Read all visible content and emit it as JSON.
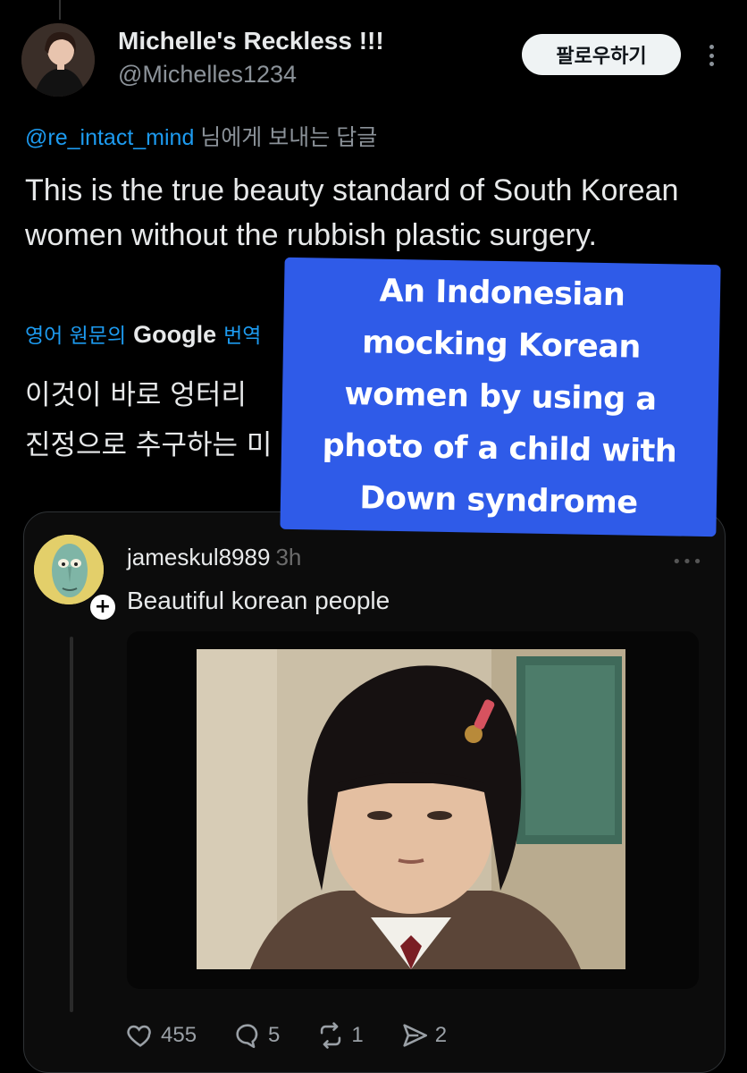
{
  "author": {
    "display_name": "Michelle's Reckless !!!",
    "handle": "@Michelles1234",
    "follow_label": "팔로우하기"
  },
  "reply_context": {
    "mention": "@re_intact_mind",
    "suffix": " 님에게 보내는 답글"
  },
  "tweet": {
    "text": "This is the true beauty standard of South Korean women without the rubbish plastic surgery.",
    "translate_prefix": "영어 원문의",
    "translate_brand": "Google",
    "translate_suffix": "번역",
    "translated_line_1": "이것이 바로 엉터리 ",
    "translated_line_2": "진정으로 추구하는 미"
  },
  "overlay": {
    "caption": "An Indonesian mocking Korean women by using a photo of a child with Down syndrome",
    "color": "#2f5be8"
  },
  "quote": {
    "username": "jameskul8989",
    "time": "3h",
    "text": "Beautiful korean people",
    "more": "•••"
  },
  "actions": {
    "likes": "455",
    "replies": "5",
    "reposts": "1",
    "shares": "2"
  },
  "icons": {
    "like": "heart-icon",
    "reply": "speech-bubble-icon",
    "repost": "repost-icon",
    "share": "share-icon",
    "more": "more-vertical-icon",
    "add": "plus-icon"
  },
  "colors": {
    "accent": "#1d9bf0",
    "background": "#000000",
    "text": "#e7e9ea",
    "muted": "#8b9299"
  }
}
